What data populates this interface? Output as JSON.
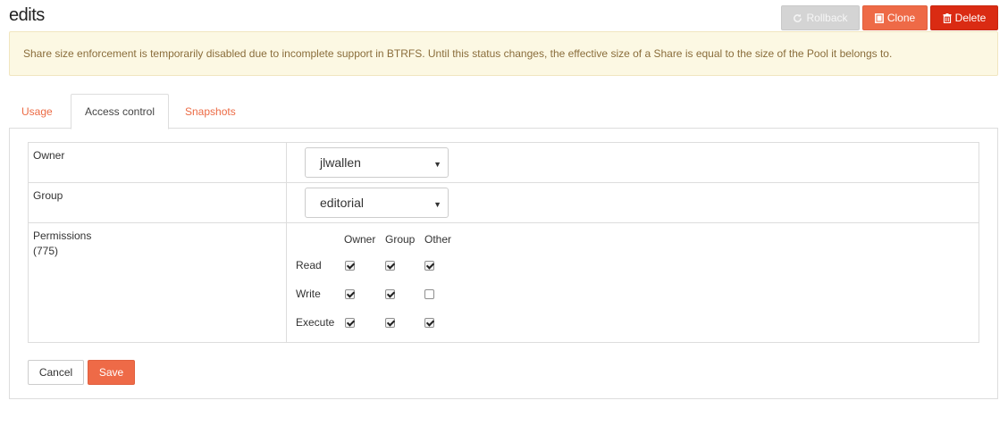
{
  "page": {
    "title": "edits"
  },
  "toolbar": {
    "rollback_label": "Rollback",
    "clone_label": "Clone",
    "delete_label": "Delete",
    "rollback_icon": "refresh-icon",
    "clone_icon": "clone-icon",
    "delete_icon": "trash-icon"
  },
  "alert": {
    "text": "Share size enforcement is temporarily disabled due to incomplete support in BTRFS. Until this status changes, the effective size of a Share is equal to the size of the Pool it belongs to."
  },
  "tabs": [
    {
      "label": "Usage",
      "active": false
    },
    {
      "label": "Access control",
      "active": true
    },
    {
      "label": "Snapshots",
      "active": false
    }
  ],
  "access": {
    "owner": {
      "label": "Owner",
      "value": "jlwallen"
    },
    "group": {
      "label": "Group",
      "value": "editorial"
    },
    "permissions": {
      "label": "Permissions",
      "octal": "(775)",
      "columns": [
        "Owner",
        "Group",
        "Other"
      ],
      "rows": [
        {
          "label": "Read",
          "values": [
            true,
            true,
            true
          ]
        },
        {
          "label": "Write",
          "values": [
            true,
            true,
            false
          ]
        },
        {
          "label": "Execute",
          "values": [
            true,
            true,
            true
          ]
        }
      ]
    }
  },
  "form": {
    "cancel_label": "Cancel",
    "save_label": "Save"
  },
  "colors": {
    "accent": "#ee6a47",
    "danger": "#da2b13",
    "disabled": "#d4d4d4",
    "alert_bg": "#fcf8e3",
    "alert_text": "#8a6d3b"
  }
}
